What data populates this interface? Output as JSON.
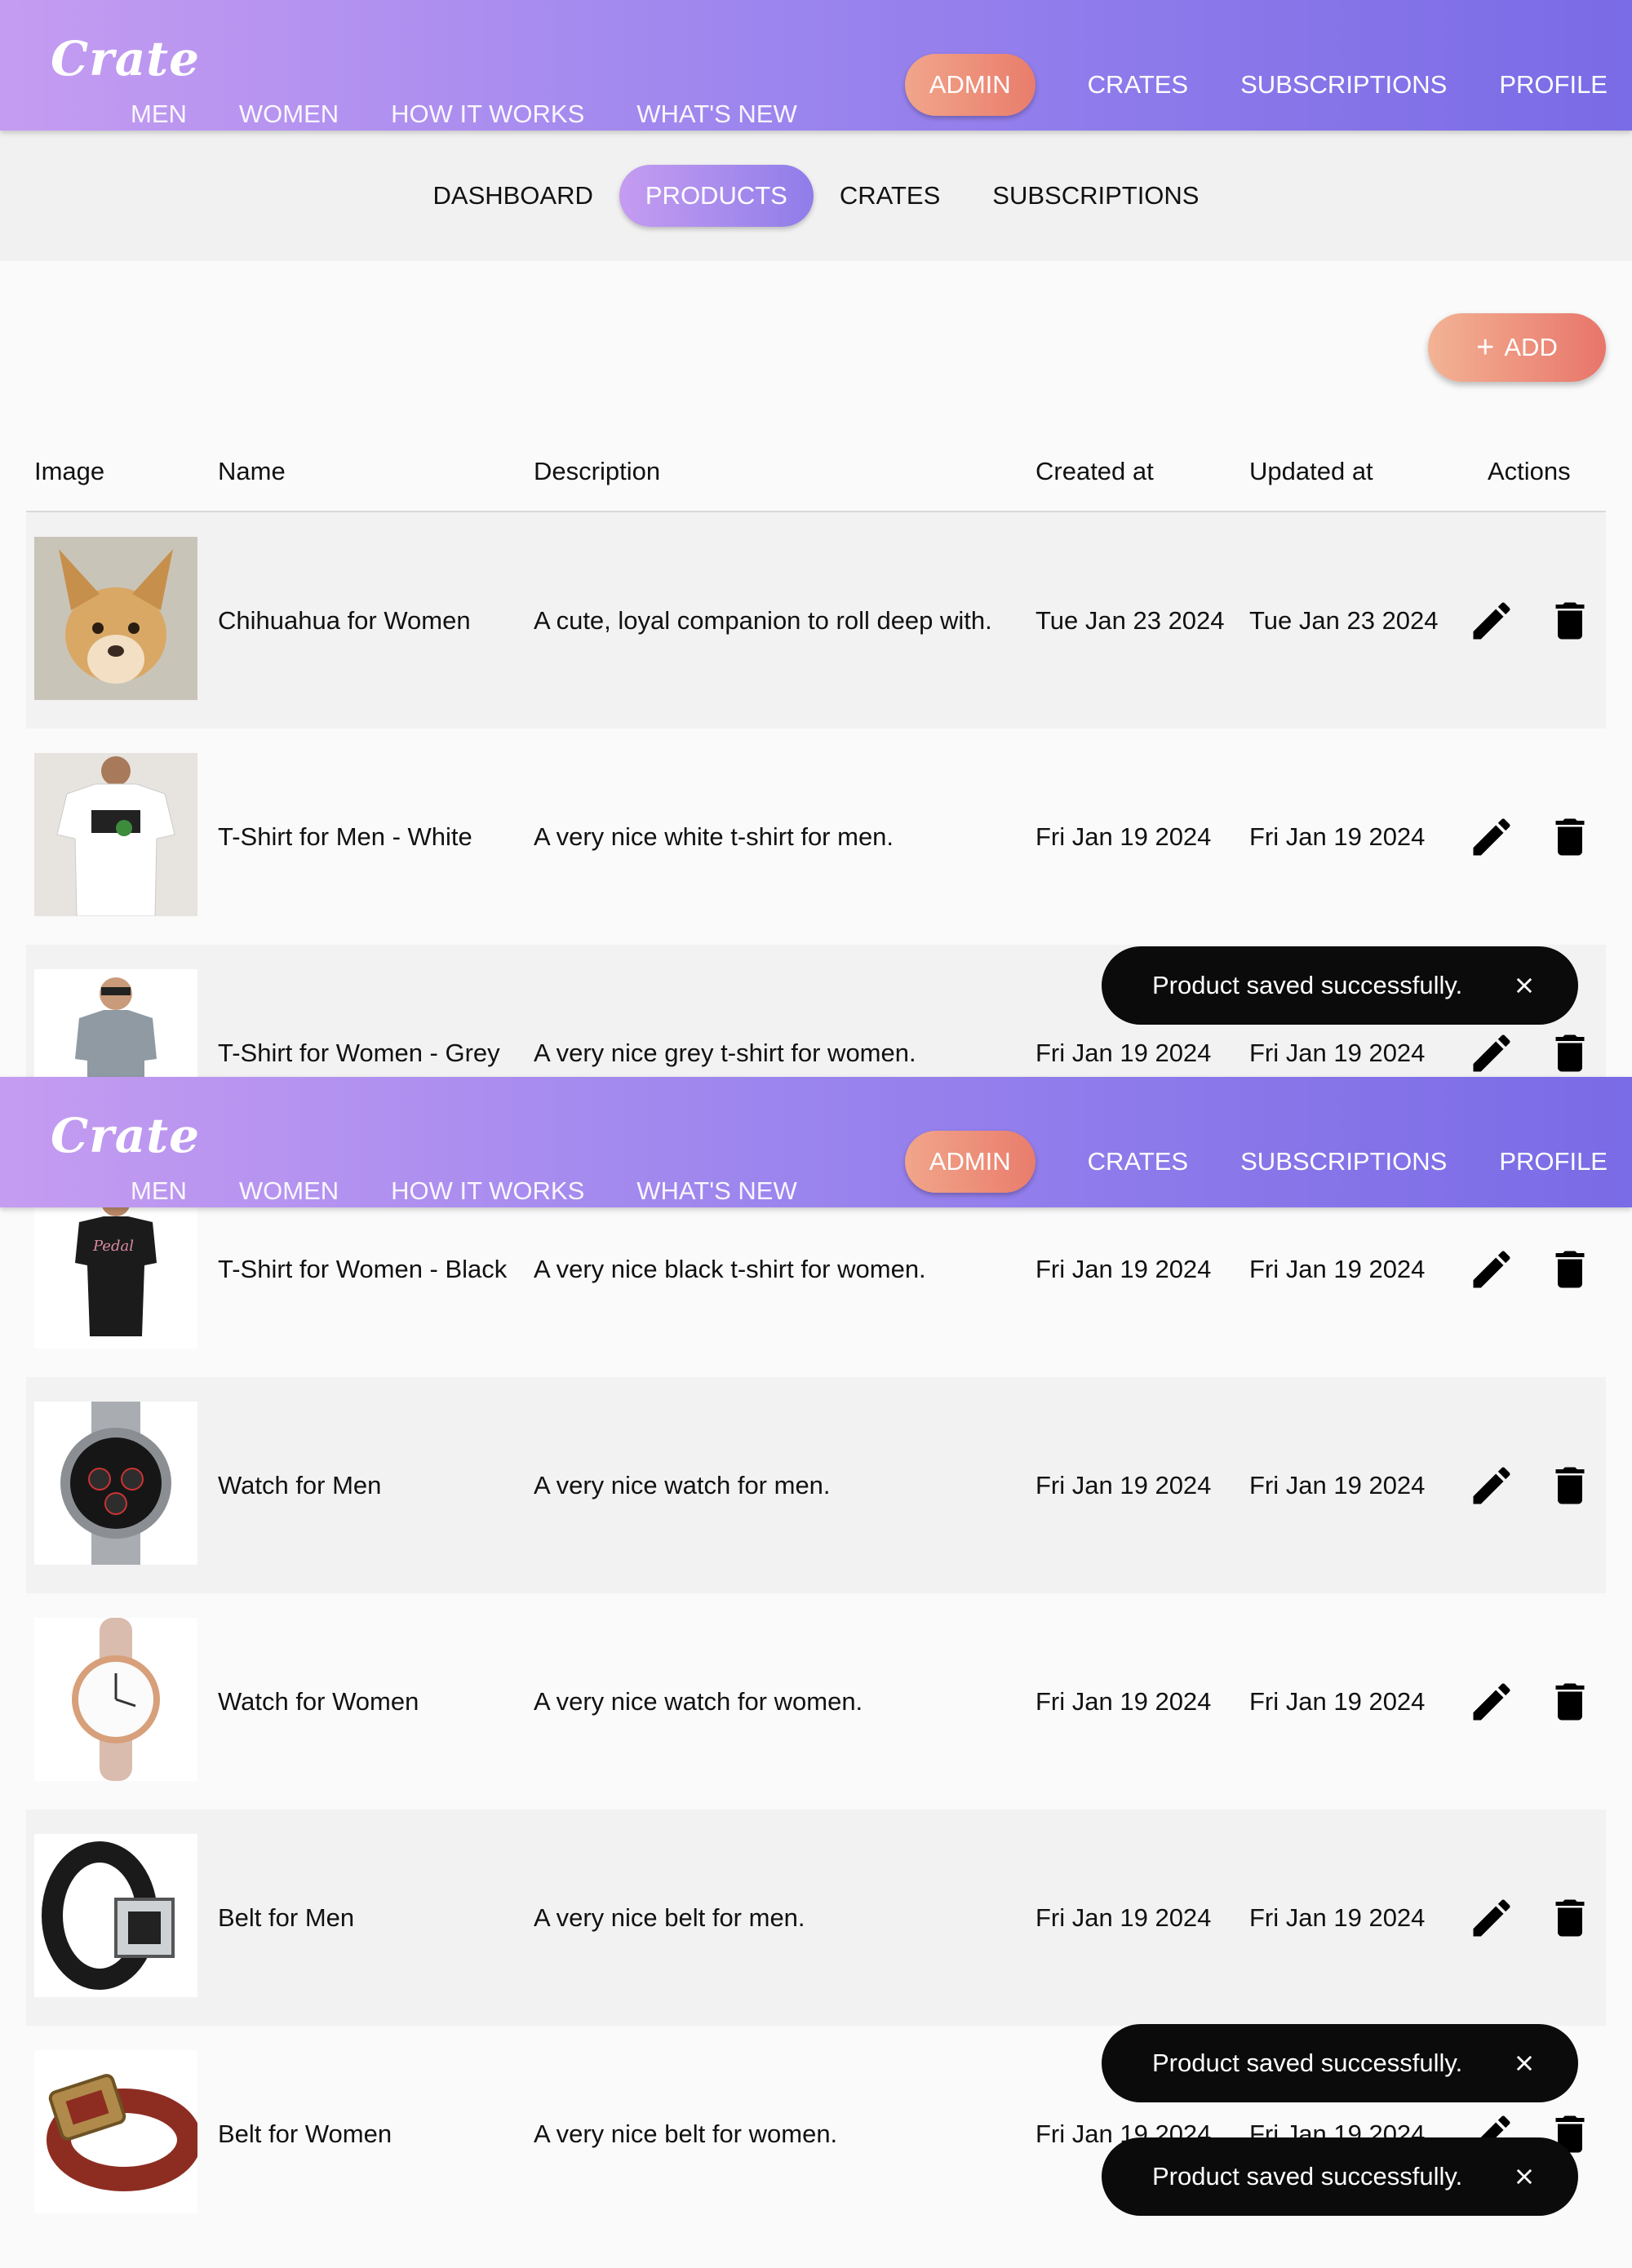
{
  "app": {
    "logo": "Crate",
    "left_nav": [
      "MEN",
      "WOMEN",
      "HOW IT WORKS",
      "WHAT'S NEW"
    ],
    "right_nav": {
      "admin": "ADMIN",
      "crates": "CRATES",
      "subscriptions": "SUBSCRIPTIONS",
      "profile": "PROFILE"
    }
  },
  "subnav": {
    "dashboard": "DASHBOARD",
    "products": "PRODUCTS",
    "crates": "CRATES",
    "subscriptions": "SUBSCRIPTIONS"
  },
  "add_button": {
    "label": "ADD"
  },
  "table": {
    "headers": {
      "image": "Image",
      "name": "Name",
      "description": "Description",
      "created": "Created at",
      "updated": "Updated at",
      "actions": "Actions"
    },
    "rows": [
      {
        "name": "Chihuahua for Women",
        "description": "A cute, loyal companion to roll deep with.",
        "created": "Tue Jan 23 2024",
        "updated": "Tue Jan 23 2024",
        "image_icon": "chihuahua-image"
      },
      {
        "name": "T-Shirt for Men - White",
        "description": "A very nice white t-shirt for men.",
        "created": "Fri Jan 19 2024",
        "updated": "Fri Jan 19 2024",
        "image_icon": "white-tshirt-image"
      },
      {
        "name": "T-Shirt for Women - Grey",
        "description": "A very nice grey t-shirt for women.",
        "created": "Fri Jan 19 2024",
        "updated": "Fri Jan 19 2024",
        "image_icon": "grey-tshirt-image"
      },
      {
        "name": "T-Shirt for Women - Black",
        "description": "A very nice black t-shirt for women.",
        "created": "Fri Jan 19 2024",
        "updated": "Fri Jan 19 2024",
        "image_icon": "black-tshirt-image"
      },
      {
        "name": "Watch for Men",
        "description": "A very nice watch for men.",
        "created": "Fri Jan 19 2024",
        "updated": "Fri Jan 19 2024",
        "image_icon": "mens-watch-image"
      },
      {
        "name": "Watch for Women",
        "description": "A very nice watch for women.",
        "created": "Fri Jan 19 2024",
        "updated": "Fri Jan 19 2024",
        "image_icon": "womens-watch-image"
      },
      {
        "name": "Belt for Men",
        "description": "A very nice belt for men.",
        "created": "Fri Jan 19 2024",
        "updated": "Fri Jan 19 2024",
        "image_icon": "mens-belt-image"
      },
      {
        "name": "Belt for Women",
        "description": "A very nice belt for women.",
        "created": "Fri Jan 19 2024",
        "updated": "Fri Jan 19 2024",
        "image_icon": "womens-belt-image"
      }
    ]
  },
  "snackbars": [
    {
      "message": "Product saved successfully."
    },
    {
      "message": "Product saved successfully."
    },
    {
      "message": "Product saved successfully."
    }
  ],
  "colors": {
    "appbar_start": "#c59cf1",
    "appbar_end": "#7a6be6",
    "accent": "#e97d6c",
    "snackbar": "#0b0b0b"
  }
}
